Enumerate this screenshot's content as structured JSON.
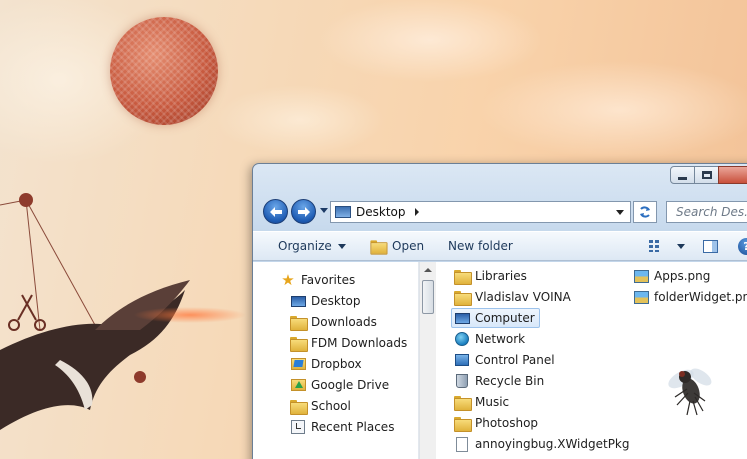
{
  "window": {
    "address": {
      "location": "Desktop"
    },
    "search": {
      "placeholder": "Search Des..."
    }
  },
  "toolbar": {
    "organize_label": "Organize",
    "open_label": "Open",
    "new_folder_label": "New folder",
    "help_label": "?"
  },
  "navigation": {
    "favorites_label": "Favorites",
    "items": [
      {
        "label": "Desktop",
        "icon": "desktop-icon"
      },
      {
        "label": "Downloads",
        "icon": "downloads-folder-icon"
      },
      {
        "label": "FDM Downloads",
        "icon": "folder-icon"
      },
      {
        "label": "Dropbox",
        "icon": "dropbox-folder-icon"
      },
      {
        "label": "Google Drive",
        "icon": "google-drive-folder-icon"
      },
      {
        "label": "School",
        "icon": "folder-icon"
      },
      {
        "label": "Recent Places",
        "icon": "recent-places-icon"
      }
    ]
  },
  "content": {
    "selected": "Computer",
    "column1": [
      {
        "label": "Libraries",
        "icon": "libraries-icon"
      },
      {
        "label": "Vladislav VOINA",
        "icon": "user-folder-icon"
      },
      {
        "label": "Computer",
        "icon": "computer-icon"
      },
      {
        "label": "Network",
        "icon": "network-icon"
      },
      {
        "label": "Control Panel",
        "icon": "control-panel-icon"
      },
      {
        "label": "Recycle Bin",
        "icon": "recycle-bin-icon"
      },
      {
        "label": "Music",
        "icon": "folder-icon"
      },
      {
        "label": "Photoshop",
        "icon": "folder-icon"
      },
      {
        "label": "annoyingbug.XWidgetPkg",
        "icon": "package-file-icon"
      }
    ],
    "column2": [
      {
        "label": "Apps.png",
        "icon": "image-file-icon"
      },
      {
        "label": "folderWidget.png",
        "icon": "image-file-icon"
      }
    ]
  },
  "colors": {
    "selection": "#d8e8fa",
    "selection_border": "#9dc3ec",
    "toolbar_text": "#1e395b"
  }
}
